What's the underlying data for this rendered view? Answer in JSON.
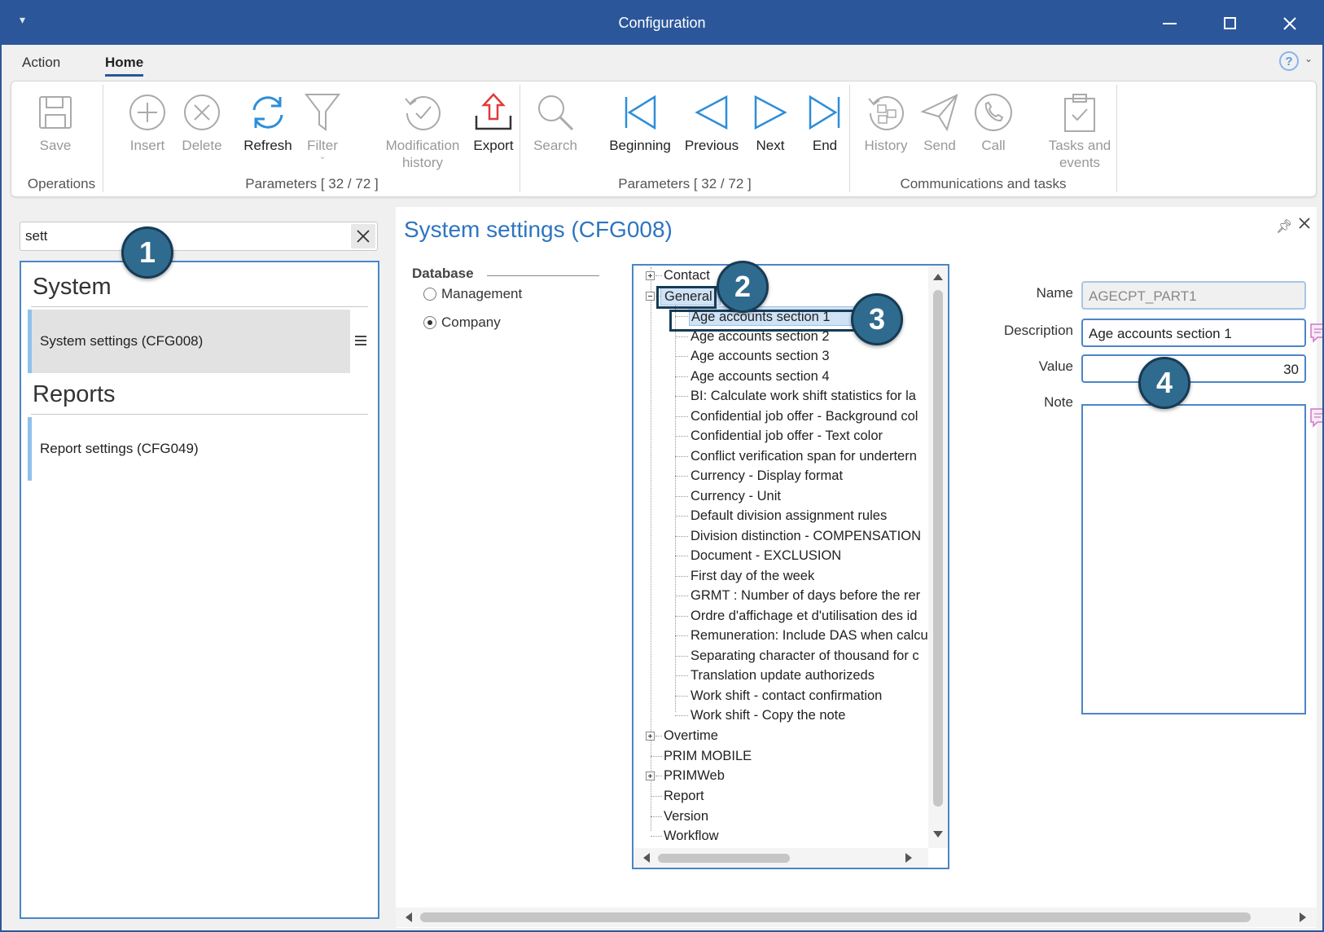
{
  "window": {
    "title": "Configuration",
    "quick_access_icon": "dropdown-arrow-icon"
  },
  "menu": {
    "tabs": [
      "Action",
      "Home"
    ],
    "active": "Home",
    "help": "?"
  },
  "ribbon": {
    "groups": [
      {
        "label": "Operations"
      },
      {
        "label": "Parameters [ 32 / 72 ]"
      },
      {
        "label": "Parameters [ 32 / 72 ]"
      },
      {
        "label": "Communications and tasks"
      }
    ],
    "buttons": {
      "save": {
        "label": "Save",
        "icon": "floppy-icon"
      },
      "insert": {
        "label": "Insert",
        "icon": "plus-circle-icon"
      },
      "delete": {
        "label": "Delete",
        "icon": "x-circle-icon"
      },
      "refresh": {
        "label": "Refresh",
        "icon": "refresh-icon"
      },
      "filter": {
        "label": "Filter",
        "icon": "funnel-icon"
      },
      "modification_history": {
        "label1": "Modification",
        "label2": "history",
        "icon": "clock-check-icon"
      },
      "export": {
        "label": "Export",
        "icon": "export-icon"
      },
      "search": {
        "label": "Search",
        "icon": "magnifier-icon"
      },
      "beginning": {
        "label": "Beginning",
        "icon": "first-icon"
      },
      "previous": {
        "label": "Previous",
        "icon": "previous-icon"
      },
      "next": {
        "label": "Next",
        "icon": "next-icon"
      },
      "end": {
        "label": "End",
        "icon": "last-icon"
      },
      "history": {
        "label": "History",
        "icon": "history-icon"
      },
      "send": {
        "label": "Send",
        "icon": "paper-plane-icon"
      },
      "call": {
        "label": "Call",
        "icon": "phone-icon"
      },
      "tasks_events": {
        "label1": "Tasks and",
        "label2": "events",
        "icon": "clipboard-icon"
      }
    }
  },
  "leftpane": {
    "search_value": "sett",
    "sections": [
      {
        "heading": "System",
        "items": [
          "System settings (CFG008)"
        ]
      },
      {
        "heading": "Reports",
        "items": [
          "Report settings (CFG049)"
        ]
      }
    ]
  },
  "main": {
    "title": "System settings (CFG008)",
    "database": {
      "label": "Database",
      "options": [
        "Management",
        "Company"
      ],
      "selected": "Company"
    },
    "tree": {
      "top_nodes": {
        "contact": "Contact",
        "general": "General",
        "overtime": "Overtime",
        "prim_mobile": "PRIM MOBILE",
        "primweb": "PRIMWeb",
        "report": "Report",
        "version": "Version",
        "workflow": "Workflow"
      },
      "general_children": [
        "Age accounts section 1",
        "Age accounts section 2",
        "Age accounts section 3",
        "Age accounts section 4",
        "BI: Calculate work shift statistics for la",
        "Confidential job offer - Background col",
        "Confidential job offer - Text color",
        "Conflict verification span for undertern",
        "Currency - Display format",
        "Currency - Unit",
        "Default division assignment rules",
        "Division distinction  - COMPENSATION",
        "Document - EXCLUSION",
        "First day of the week",
        "GRMT : Number of days before the rer",
        "Ordre d'affichage et d'utilisation des id",
        "Remuneration: Include DAS when calcu",
        "Separating character of thousand for c",
        "Translation update authorizeds",
        "Work shift - contact confirmation",
        "Work shift - Copy the note"
      ],
      "selected": "Age accounts section 1"
    },
    "form": {
      "name_label": "Name",
      "name_value": "AGECPT_PART1",
      "description_label": "Description",
      "description_value": "Age accounts section 1",
      "value_label": "Value",
      "value_value": "30",
      "note_label": "Note",
      "note_value": ""
    }
  },
  "callouts": [
    "1",
    "2",
    "3",
    "4"
  ]
}
